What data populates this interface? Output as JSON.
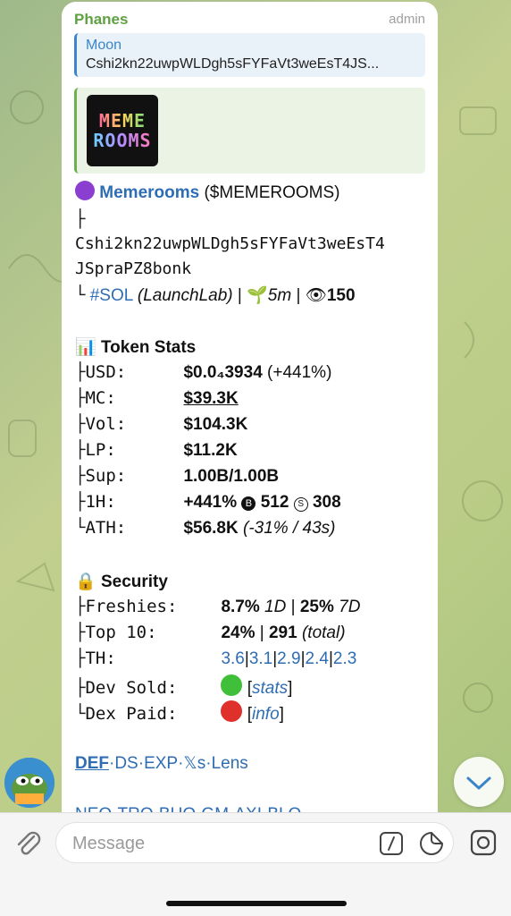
{
  "message": {
    "sender": "Phanes",
    "role": "admin",
    "reply": {
      "name": "Moon",
      "text": "Cshi2kn22uwpWLDgh5sFYFaVt3weEsT4JS..."
    },
    "preview_logo": {
      "line1": "MEME",
      "line2": "ROOMS"
    },
    "token": {
      "name": "Memerooms",
      "ticker": "($MEMEROOMS)",
      "address_line1": "Cshi2kn22uwpWLDgh5sFYFaVt3weEsT4",
      "address_line2": "JSpraPZ8bonk",
      "chain": "#SOL",
      "platform": "(LaunchLab)",
      "age": "5m",
      "views": "150"
    },
    "token_stats": {
      "title": "Token Stats",
      "usd_label": "USD:",
      "usd_value": "$0.0₄3934",
      "usd_change": "(+441%)",
      "mc_label": "MC:",
      "mc_value": "$39.3K",
      "vol_label": "Vol:",
      "vol_value": "$104.3K",
      "lp_label": "LP:",
      "lp_value": "$11.2K",
      "sup_label": "Sup:",
      "sup_value": "1.00B/1.00B",
      "h1_label": "1H:",
      "h1_change": "+441%",
      "h1_buys": "512",
      "h1_sells": "308",
      "ath_label": "ATH:",
      "ath_value": "$56.8K",
      "ath_detail": "(-31% / 43s)"
    },
    "security": {
      "title": "Security",
      "freshies_label": "Freshies:",
      "freshies_1d": "8.7%",
      "freshies_1d_unit": "1D",
      "freshies_7d": "25%",
      "freshies_7d_unit": "7D",
      "top10_label": "Top 10:",
      "top10_pct": "24%",
      "top10_total": "291",
      "top10_total_label": "(total)",
      "th_label": "TH:",
      "th_values": [
        "3.6",
        "3.1",
        "2.9",
        "2.4",
        "2.3"
      ],
      "dev_sold_label": "Dev Sold:",
      "dev_sold_link": "stats",
      "dex_paid_label": "Dex Paid:",
      "dex_paid_link": "info"
    },
    "links_row": [
      "DEF",
      "DS",
      "EXP",
      "𝕏s",
      "Lens"
    ],
    "links_row2_partial": "NEO·TRO·BUO·GM·AXI·BLO"
  },
  "composer": {
    "placeholder": "Message"
  },
  "colors": {
    "accent_link": "#2e6db3",
    "sender": "#5fa043",
    "reply_accent": "#3a86c8",
    "status_green": "#3fbf3a",
    "status_red": "#e0302b"
  },
  "icons": [
    "paperclip-icon",
    "command-icon",
    "sticker-icon",
    "camera-icon",
    "chevron-down-icon",
    "avatar"
  ]
}
